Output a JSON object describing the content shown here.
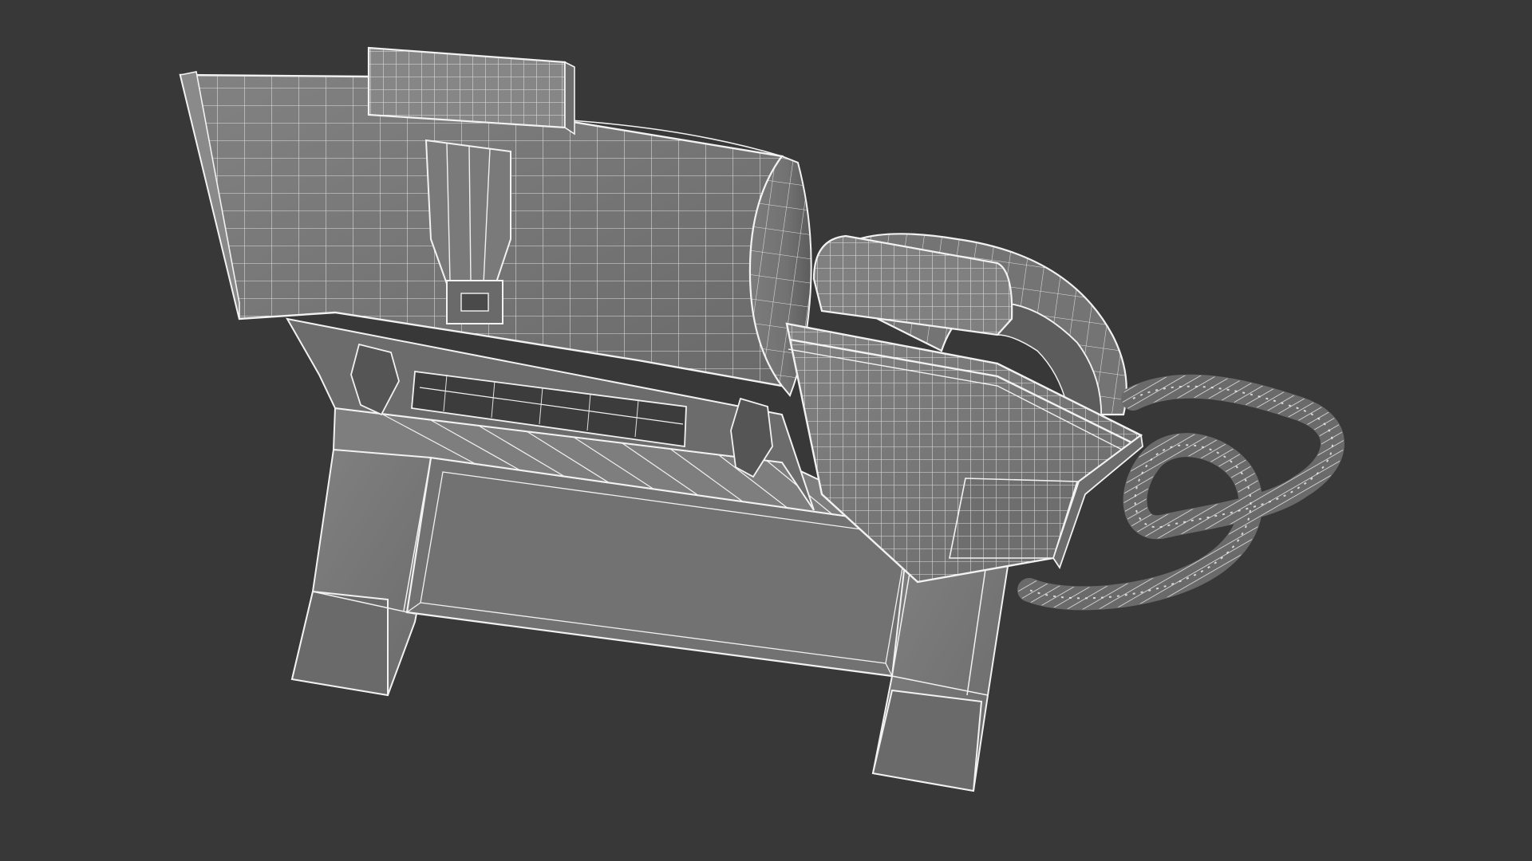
{
  "scene": {
    "subject": "desk-phone-wireframe-render",
    "background_color": "#383838",
    "surface_color": "#767676",
    "surface_shadow_color": "#5e5e5e",
    "surface_highlight_color": "#8a8a8a",
    "wire_color": "#f2f2f2"
  }
}
